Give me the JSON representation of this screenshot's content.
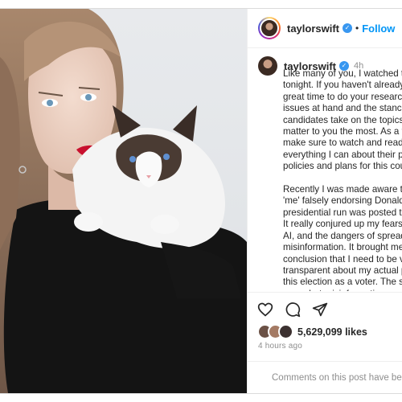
{
  "header": {
    "username": "taylorswift",
    "verified_icon": "verified-badge-icon",
    "separator": "•",
    "follow_label": "Follow"
  },
  "caption": {
    "username": "taylorswift",
    "time": "4h",
    "text": "Like many of you, I watched the\ntonight. If you haven't already,\ngreat time to do your research\nissues at hand and the stances\ncandidates take on the topics t\nmatter to you the most. As a vo\nmake sure to watch and read\neverything I can about their pro\npolicies and plans for this coun\n\nRecently I was made aware tha\n'me' falsely endorsing Donald T\npresidential run was posted to\nIt really conjured up my fears a\nAI, and the dangers of spreadin\nmisinformation. It brought me\nconclusion that I need to be ve\ntransparent about my actual pl\nthis election as a voter. The sim\nrecombat misinformation"
  },
  "actions": {
    "like_icon": "heart-icon",
    "comment_icon": "comment-icon",
    "share_icon": "share-icon"
  },
  "likes": {
    "count": "5,629,099 likes"
  },
  "posted": "4 hours ago",
  "comments_notice": "Comments on this post have been",
  "colors": {
    "accent": "#0095f6",
    "verified": "#3897f0",
    "lipstick": "#c8102e",
    "border": "#dbdbdb"
  }
}
